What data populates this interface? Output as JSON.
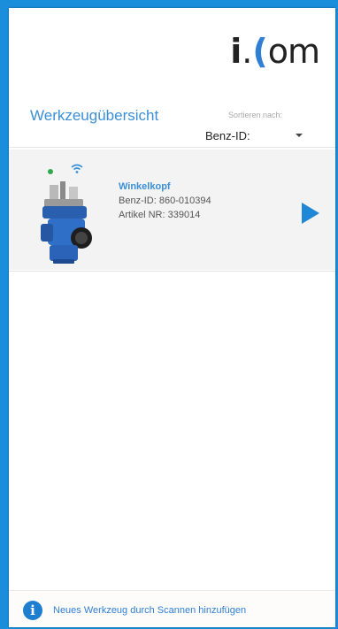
{
  "header": {
    "logo_text": "i.om",
    "title": "Werkzeugübersicht"
  },
  "sort": {
    "label": "Sortieren nach:",
    "value": "Benz-ID:"
  },
  "tools": [
    {
      "name": "Winkelkopf",
      "benz_id": "Benz-ID: 860-010394",
      "article_nr": "Artikel NR: 339014",
      "status_color": "#2fa84a",
      "connection_icon": "wifi-icon"
    }
  ],
  "footer": {
    "link_text": "Neues Werkzeug durch Scannen hinzufügen",
    "icon": "info-icon"
  },
  "colors": {
    "accent": "#1a8ddb",
    "link": "#3b8fd6"
  }
}
